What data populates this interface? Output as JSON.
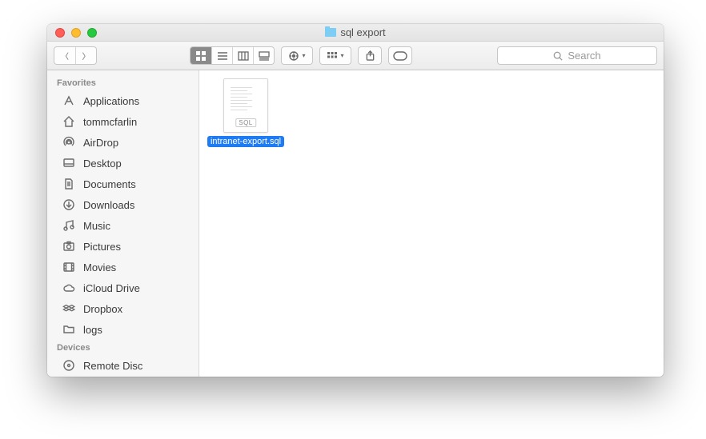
{
  "window": {
    "title": "sql export"
  },
  "search": {
    "placeholder": "Search"
  },
  "sidebar": {
    "favorites_label": "Favorites",
    "devices_label": "Devices",
    "favorites": [
      {
        "label": "Applications"
      },
      {
        "label": "tommcfarlin"
      },
      {
        "label": "AirDrop"
      },
      {
        "label": "Desktop"
      },
      {
        "label": "Documents"
      },
      {
        "label": "Downloads"
      },
      {
        "label": "Music"
      },
      {
        "label": "Pictures"
      },
      {
        "label": "Movies"
      },
      {
        "label": "iCloud Drive"
      },
      {
        "label": "Dropbox"
      },
      {
        "label": "logs"
      }
    ],
    "devices": [
      {
        "label": "Remote Disc"
      }
    ]
  },
  "files": [
    {
      "name": "intranet-export.sql",
      "badge": "SQL",
      "selected": true
    }
  ]
}
